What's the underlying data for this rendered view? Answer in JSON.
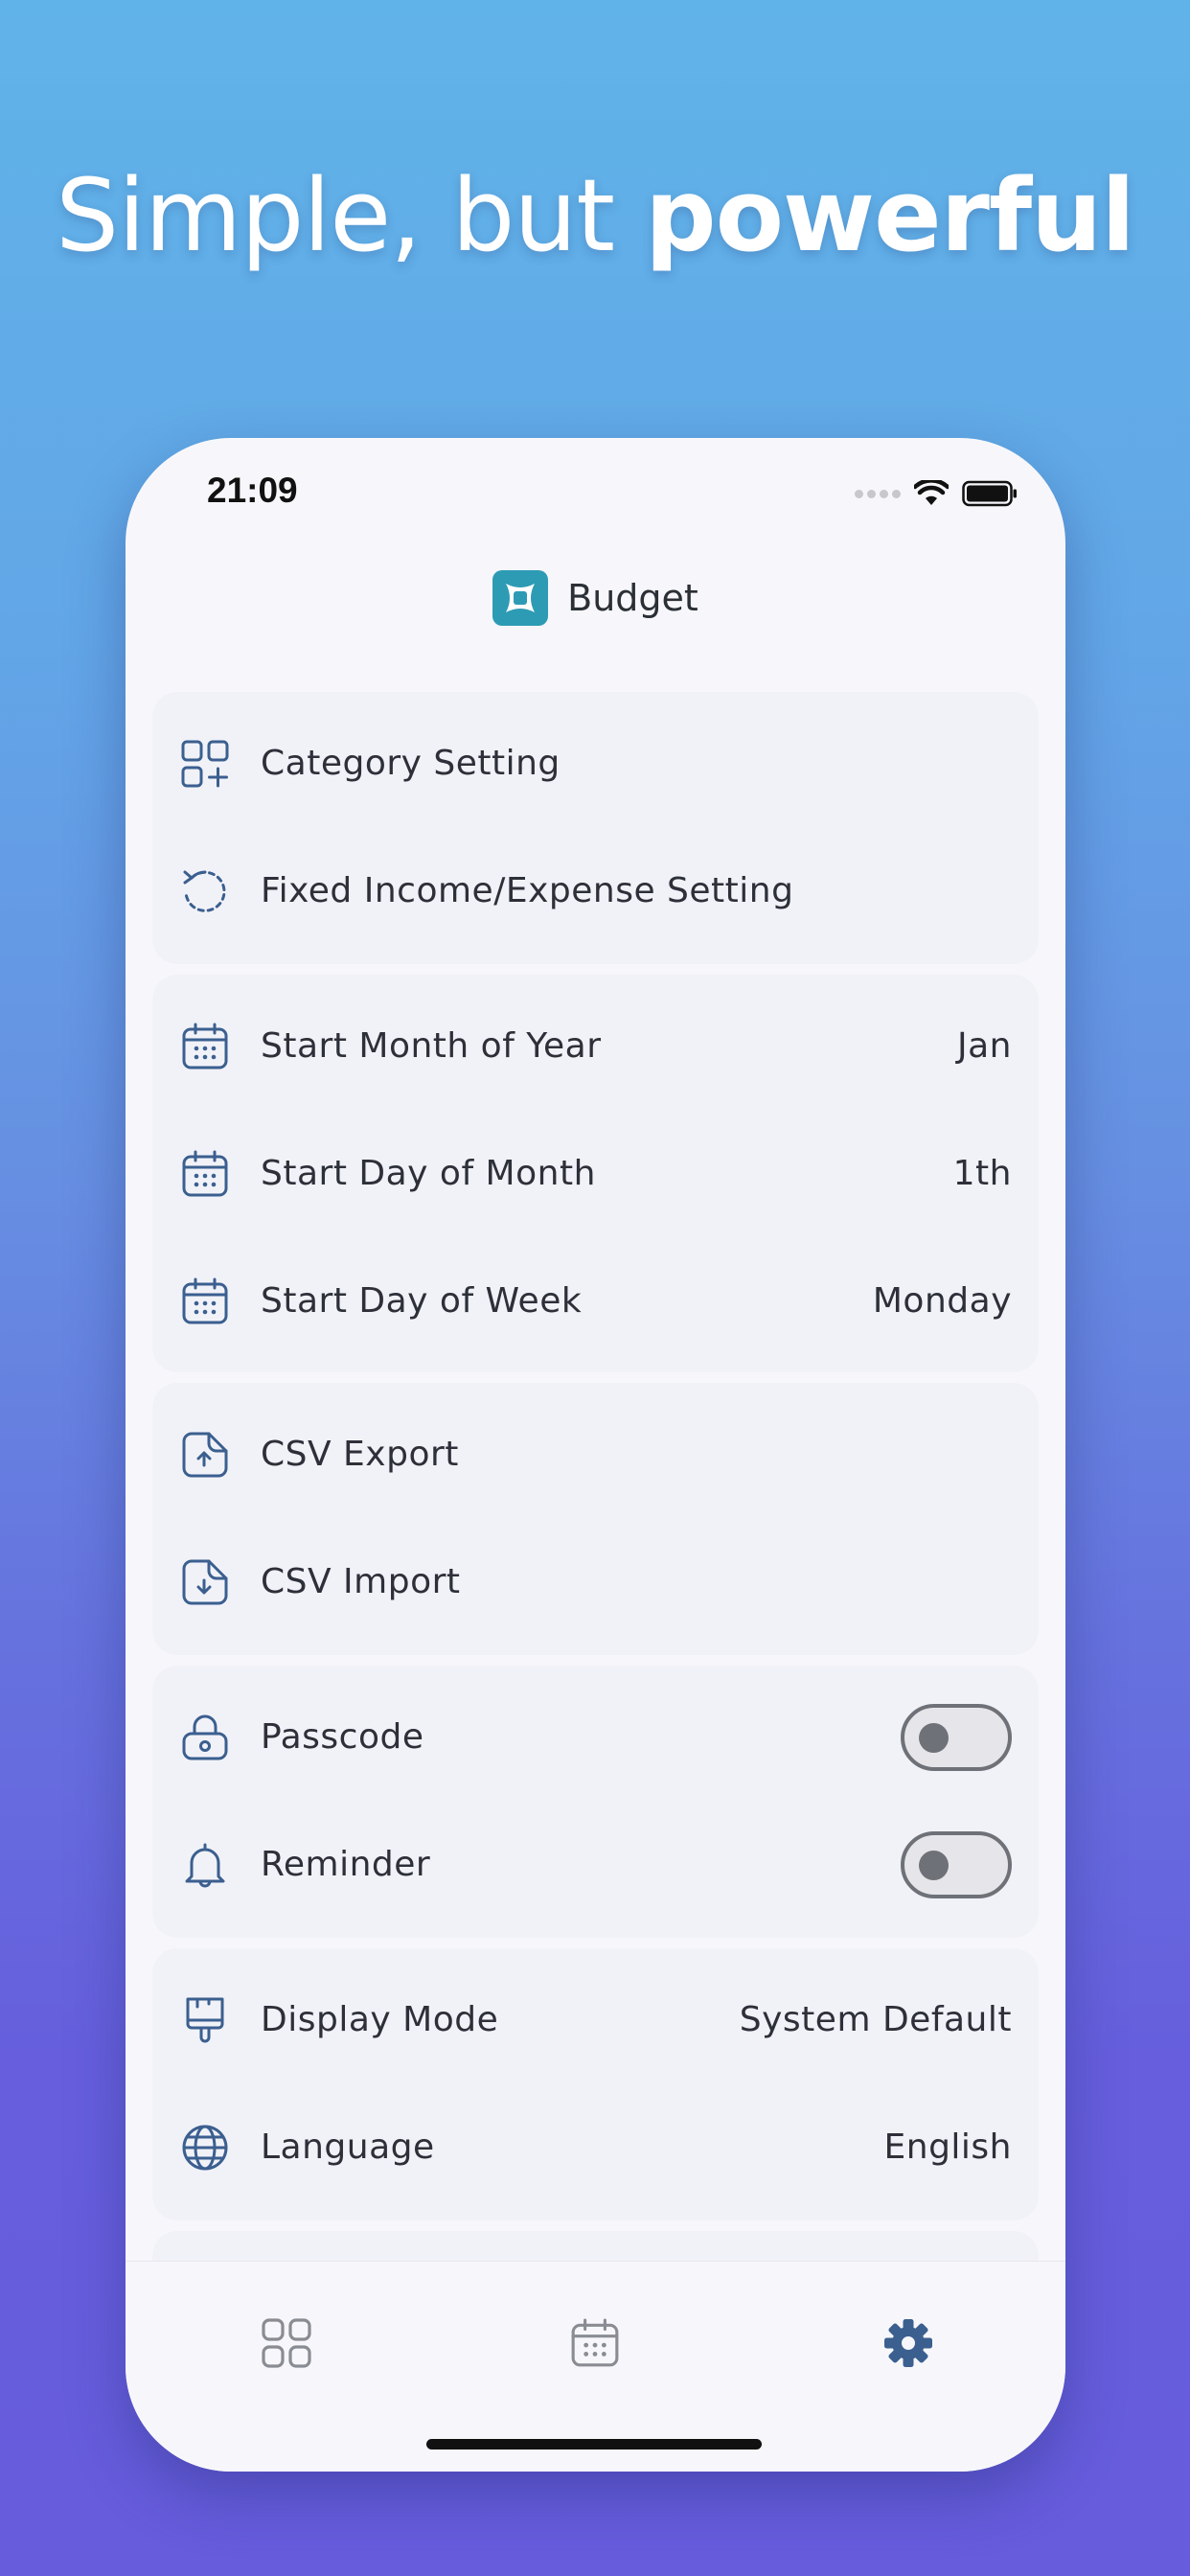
{
  "headline": {
    "regular": "Simple, but ",
    "bold": "powerful"
  },
  "status_bar": {
    "time": "21:09"
  },
  "app": {
    "title": "Budget",
    "accent": "#2e9bb5"
  },
  "sections": {
    "general": [
      {
        "label": "Category Setting",
        "icon": "category-grid-icon"
      },
      {
        "label": "Fixed Income/Expense Setting",
        "icon": "refresh-icon"
      }
    ],
    "dates": [
      {
        "label": "Start Month of Year",
        "value": "Jan",
        "icon": "calendar-icon"
      },
      {
        "label": "Start Day of Month",
        "value": "1th",
        "icon": "calendar-icon"
      },
      {
        "label": "Start Day of Week",
        "value": "Monday",
        "icon": "calendar-icon"
      }
    ],
    "csv": [
      {
        "label": "CSV Export",
        "icon": "file-upload-icon"
      },
      {
        "label": "CSV Import",
        "icon": "file-download-icon"
      }
    ],
    "security": [
      {
        "label": "Passcode",
        "icon": "lock-icon",
        "enabled": false
      },
      {
        "label": "Reminder",
        "icon": "bell-icon",
        "enabled": false
      }
    ],
    "display": [
      {
        "label": "Display Mode",
        "value": "System Default",
        "icon": "brush-icon"
      },
      {
        "label": "Language",
        "value": "English",
        "icon": "globe-icon"
      }
    ]
  },
  "tab_bar": {
    "tabs": [
      {
        "name": "dashboard",
        "icon": "grid-icon",
        "active": false
      },
      {
        "name": "calendar",
        "icon": "calendar-icon",
        "active": false
      },
      {
        "name": "settings",
        "icon": "gear-icon",
        "active": true
      }
    ],
    "active_color": "#3b5f8f",
    "inactive_color": "#8a8c93"
  },
  "colors": {
    "icon": "#3b5f8f",
    "text": "#2d3039",
    "card": "#f1f2f8"
  }
}
